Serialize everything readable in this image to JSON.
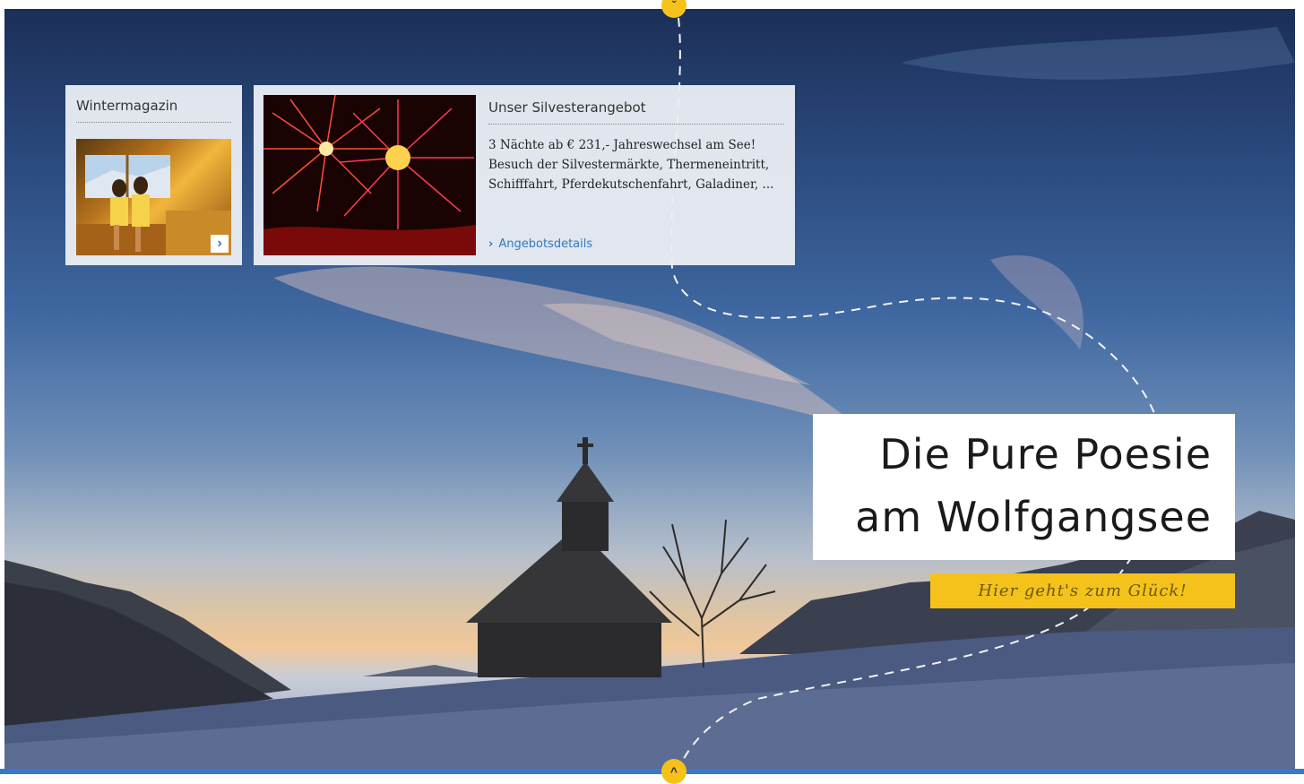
{
  "magazine": {
    "title": "Wintermagazin",
    "thumb_icon": "chevron-right-icon",
    "thumb_arrow": "›"
  },
  "offer": {
    "title": "Unser Silvesterangebot",
    "text": "3 Nächte ab € 231,- Jahreswechsel am See! Besuch der Silvestermärkte, Thermeneintritt, Schifffahrt, Pferdekutschenfahrt, Galadiner, ...",
    "link_label": "Angebotsdetails",
    "link_icon": "chevron-right-icon"
  },
  "headline": {
    "line1": "Die Pure Poesie",
    "line2": "am Wolfgangsee"
  },
  "cta": {
    "label": "Hier geht's zum Glück!"
  },
  "nav": {
    "up_icon": "chevron-up-icon",
    "down_icon": "chevron-down-icon"
  },
  "colors": {
    "accent": "#f4c21b",
    "link": "#2e7ac4",
    "bar": "#3a78c9"
  }
}
